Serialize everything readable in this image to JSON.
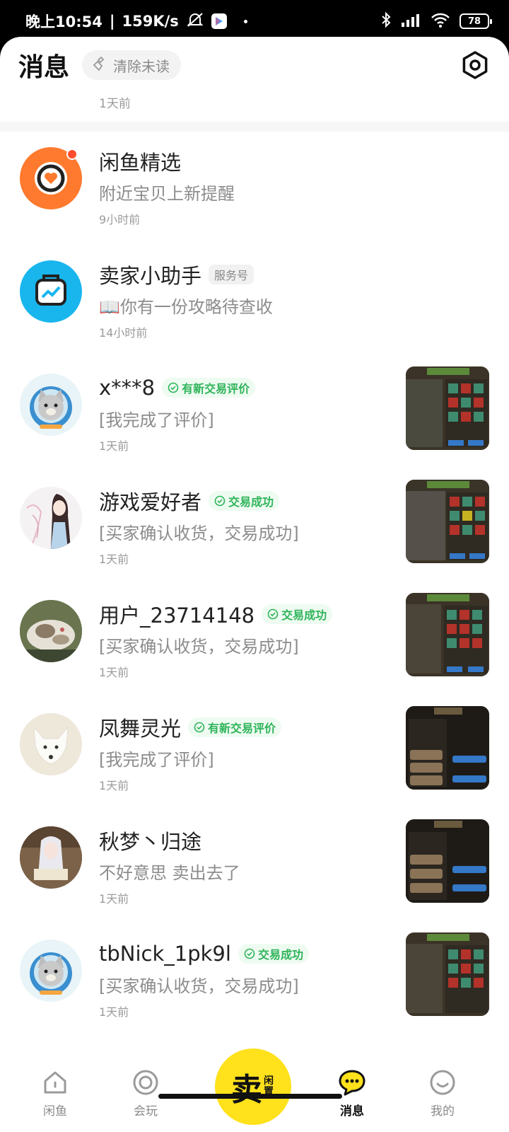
{
  "status_bar": {
    "time": "晚上10:54",
    "speed": "159K/s",
    "battery": "78"
  },
  "header": {
    "title": "消息",
    "clear_label": "清除未读"
  },
  "previous_time": "1天前",
  "conversations": [
    {
      "name": "闲鱼精选",
      "message": "附近宝贝上新提醒",
      "time": "9小时前",
      "badge": ""
    },
    {
      "name": "卖家小助手",
      "message": "📖你有一份攻略待查收",
      "time": "14小时前",
      "badge": "服务号"
    },
    {
      "name": "x***8",
      "message": "[我完成了评价]",
      "time": "1天前",
      "badge": "有新交易评价"
    },
    {
      "name": "游戏爱好者",
      "message": "[买家确认收货，交易成功]",
      "time": "1天前",
      "badge": "交易成功"
    },
    {
      "name": "用户_23714148",
      "message": "[买家确认收货，交易成功]",
      "time": "1天前",
      "badge": "交易成功"
    },
    {
      "name": "凤舞灵光",
      "message": "[我完成了评价]",
      "time": "1天前",
      "badge": "有新交易评价"
    },
    {
      "name": "秋梦丶归途",
      "message": "不好意思 卖出去了",
      "time": "1天前",
      "badge": ""
    },
    {
      "name": "tbNick_1pk9l",
      "message": "[买家确认收货，交易成功]",
      "time": "1天前",
      "badge": "交易成功"
    }
  ],
  "nav": {
    "home": "闲鱼",
    "play": "会玩",
    "sell_main": "卖",
    "sell_sub": "闲置",
    "messages": "消息",
    "mine": "我的"
  },
  "colors": {
    "accent_yellow": "#ffe11c",
    "badge_green": "#2fb45a",
    "unread_red": "#ff4d2e"
  }
}
